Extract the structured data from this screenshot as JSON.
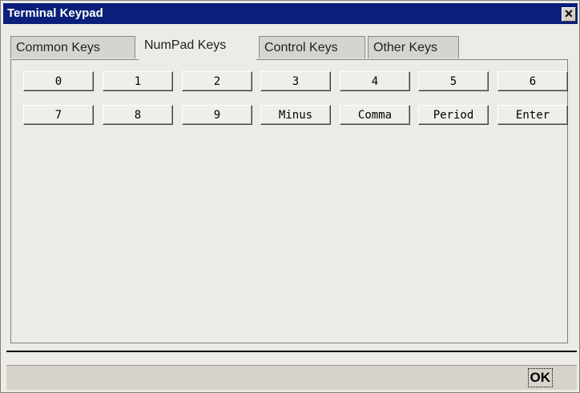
{
  "window": {
    "title": "Terminal Keypad",
    "close_glyph": "✕"
  },
  "tabs": [
    {
      "label": "Common Keys",
      "active": false
    },
    {
      "label": "NumPad Keys",
      "active": true
    },
    {
      "label": "Control Keys",
      "active": false
    },
    {
      "label": "Other Keys",
      "active": false
    }
  ],
  "keys": {
    "row1": [
      "0",
      "1",
      "2",
      "3",
      "4",
      "5",
      "6"
    ],
    "row2": [
      "7",
      "8",
      "9",
      "Minus",
      "Comma",
      "Period",
      "Enter"
    ]
  },
  "footer": {
    "ok_label": "OK"
  }
}
